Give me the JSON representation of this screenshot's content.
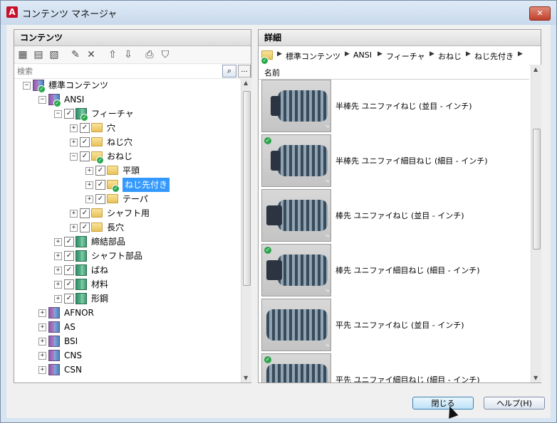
{
  "window": {
    "title": "コンテンツ マネージャ",
    "app_icon": "A",
    "close_label": "✕"
  },
  "left_panel": {
    "header": "コンテンツ",
    "toolbar_icons": [
      "new-content-icon",
      "add-content-icon",
      "import-icon",
      "edit-icon",
      "delete-icon",
      "move-up-icon",
      "move-down-icon",
      "print-icon",
      "filter-icon"
    ],
    "search_placeholder": "検索",
    "search_button": "⌕",
    "more_button": "...",
    "tree": [
      {
        "label": "標準コンテンツ",
        "level": 0,
        "icon": "book",
        "exp": "−",
        "check": false,
        "badge": true
      },
      {
        "label": "ANSI",
        "level": 1,
        "icon": "book",
        "exp": "−",
        "check": false,
        "badge": true
      },
      {
        "label": "フィーチャ",
        "level": 2,
        "icon": "book-green",
        "exp": "−",
        "check": true,
        "badge": true
      },
      {
        "label": "穴",
        "level": 3,
        "icon": "folder",
        "exp": "+",
        "check": true,
        "badge": false
      },
      {
        "label": "ねじ穴",
        "level": 3,
        "icon": "folder",
        "exp": "+",
        "check": true,
        "badge": false
      },
      {
        "label": "おねじ",
        "level": 3,
        "icon": "folder",
        "exp": "−",
        "check": true,
        "badge": true
      },
      {
        "label": "平頭",
        "level": 4,
        "icon": "folder",
        "exp": "+",
        "check": true,
        "badge": false
      },
      {
        "label": "ねじ先付き",
        "level": 4,
        "icon": "folder",
        "exp": "+",
        "check": true,
        "badge": true,
        "selected": true
      },
      {
        "label": "テーパ",
        "level": 4,
        "icon": "folder",
        "exp": "+",
        "check": true,
        "badge": false
      },
      {
        "label": "シャフト用",
        "level": 3,
        "icon": "folder",
        "exp": "+",
        "check": true,
        "badge": false
      },
      {
        "label": "長穴",
        "level": 3,
        "icon": "folder",
        "exp": "+",
        "check": true,
        "badge": false
      },
      {
        "label": "締結部品",
        "level": 2,
        "icon": "book-green",
        "exp": "+",
        "check": true,
        "badge": false
      },
      {
        "label": "シャフト部品",
        "level": 2,
        "icon": "book-green",
        "exp": "+",
        "check": true,
        "badge": false
      },
      {
        "label": "ばね",
        "level": 2,
        "icon": "book-green",
        "exp": "+",
        "check": true,
        "badge": false
      },
      {
        "label": "材料",
        "level": 2,
        "icon": "book-green",
        "exp": "+",
        "check": true,
        "badge": false
      },
      {
        "label": "形鋼",
        "level": 2,
        "icon": "book-green",
        "exp": "+",
        "check": true,
        "badge": false
      },
      {
        "label": "AFNOR",
        "level": 1,
        "icon": "book",
        "exp": "+",
        "check": false,
        "badge": false
      },
      {
        "label": "AS",
        "level": 1,
        "icon": "book",
        "exp": "+",
        "check": false,
        "badge": false
      },
      {
        "label": "BSI",
        "level": 1,
        "icon": "book",
        "exp": "+",
        "check": false,
        "badge": false
      },
      {
        "label": "CNS",
        "level": 1,
        "icon": "book",
        "exp": "+",
        "check": false,
        "badge": false
      },
      {
        "label": "CSN",
        "level": 1,
        "icon": "book",
        "exp": "+",
        "check": false,
        "badge": false
      }
    ]
  },
  "right_panel": {
    "header": "詳細",
    "breadcrumb": [
      "標準コンテンツ",
      "ANSI",
      "フィーチャ",
      "おねじ",
      "ねじ先付き"
    ],
    "column_header": "名前",
    "items": [
      {
        "label": "半棒先 ユニファイねじ (並目 - インチ)",
        "badge": false,
        "tip": "round"
      },
      {
        "label": "半棒先 ユニファイ細目ねじ (細目 - インチ)",
        "badge": true,
        "tip": "round"
      },
      {
        "label": "棒先 ユニファイねじ (並目 - インチ)",
        "badge": false,
        "tip": "dog"
      },
      {
        "label": "棒先 ユニファイ細目ねじ (細目 - インチ)",
        "badge": true,
        "tip": "dog"
      },
      {
        "label": "平先 ユニファイねじ (並目 - インチ)",
        "badge": false,
        "tip": "flat"
      },
      {
        "label": "平先 ユニファイ細目ねじ (細目 - インチ)",
        "badge": true,
        "tip": "flat"
      }
    ]
  },
  "buttons": {
    "close": "閉じる",
    "help": "ヘルプ(H)"
  }
}
